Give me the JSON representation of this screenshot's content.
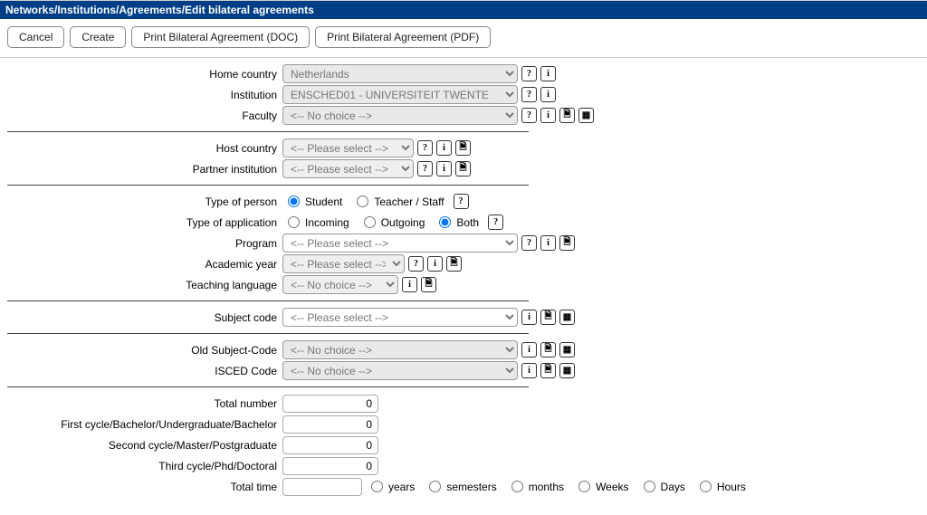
{
  "breadcrumb": "Networks/Institutions/Agreements/Edit bilateral agreements",
  "buttons": {
    "cancel": "Cancel",
    "create": "Create",
    "print_doc": "Print Bilateral Agreement (DOC)",
    "print_pdf": "Print Bilateral Agreement (PDF)"
  },
  "labels": {
    "home_country": "Home country",
    "institution": "Institution",
    "faculty": "Faculty",
    "host_country": "Host country",
    "partner_institution": "Partner institution",
    "type_of_person": "Type of person",
    "type_of_application": "Type of application",
    "program": "Program",
    "academic_year": "Academic year",
    "teaching_language": "Teaching language",
    "subject_code": "Subject code",
    "old_subject_code": "Old Subject-Code",
    "isced_code": "ISCED Code",
    "total_number": "Total number",
    "first_cycle": "First cycle/Bachelor/Undergraduate/Bachelor",
    "second_cycle": "Second cycle/Master/Postgraduate",
    "third_cycle": "Third cycle/Phd/Doctoral",
    "total_time": "Total time"
  },
  "values": {
    "home_country": "Netherlands",
    "institution": "ENSCHED01 - UNIVERSITEIT TWENTE",
    "faculty": "<-- No choice -->",
    "host_country": "<-- Please select -->",
    "partner_institution": "<-- Please select -->",
    "program": "<-- Please select -->",
    "academic_year": "<-- Please select -->",
    "teaching_language": "<-- No choice -->",
    "subject_code": "<-- Please select -->",
    "old_subject_code": "<-- No choice -->",
    "isced_code": "<-- No choice -->",
    "total_number": "0",
    "first_cycle": "0",
    "second_cycle": "0",
    "third_cycle": "0",
    "total_time": ""
  },
  "radios": {
    "person_student": "Student",
    "person_teacher": "Teacher / Staff",
    "app_incoming": "Incoming",
    "app_outgoing": "Outgoing",
    "app_both": "Both",
    "time_years": "years",
    "time_semesters": "semesters",
    "time_months": "months",
    "time_weeks": "Weeks",
    "time_days": "Days",
    "time_hours": "Hours"
  },
  "icons": {
    "help": "?",
    "info": "i",
    "doc": "🗎",
    "list": "▦"
  }
}
